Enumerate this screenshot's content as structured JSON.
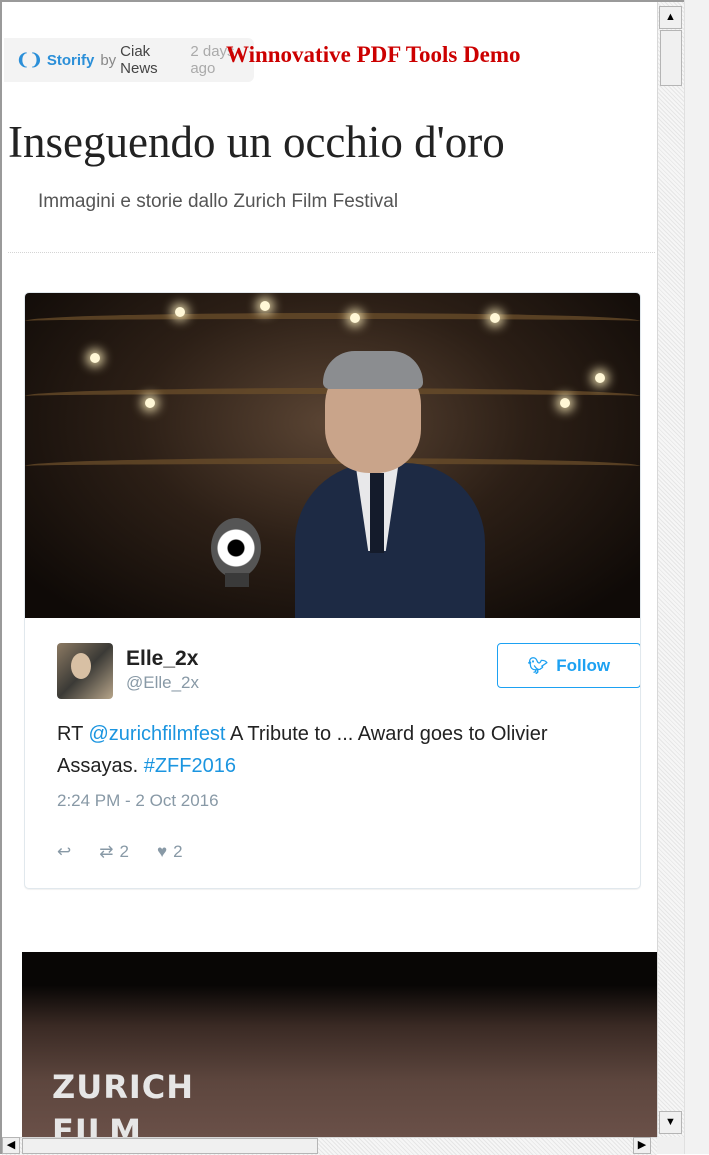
{
  "header": {
    "storify_label": "Storify",
    "by_label": "by",
    "author": "Ciak News",
    "posted_ago": "2 days ago",
    "watermark": "Winnovative PDF Tools Demo"
  },
  "story": {
    "title": "Inseguendo un occhio d'oro",
    "subtitle": "Immagini e storie dallo Zurich Film Festival"
  },
  "tweet": {
    "name": "Elle_2x",
    "handle": "@Elle_2x",
    "follow_label": "Follow",
    "text_prefix": "RT ",
    "mention": "@zurichfilmfest",
    "text_middle": " A Tribute to ... Award goes to Olivier Assayas. ",
    "hashtag": "#ZFF2016",
    "timestamp": "2:24 PM - 2 Oct 2016",
    "retweets": "2",
    "likes": "2"
  },
  "second_media": {
    "visible_text_line1": "ZURICH",
    "visible_text_line2": "FILM"
  },
  "colors": {
    "accent": "#1da1f2",
    "storify_brand": "#2b8fd8",
    "watermark": "#cc0000"
  },
  "icons": {
    "storify": "storify-icon",
    "follow": "twitter-bird-icon",
    "reply": "reply-icon",
    "retweet": "retweet-icon",
    "like": "heart-icon"
  }
}
